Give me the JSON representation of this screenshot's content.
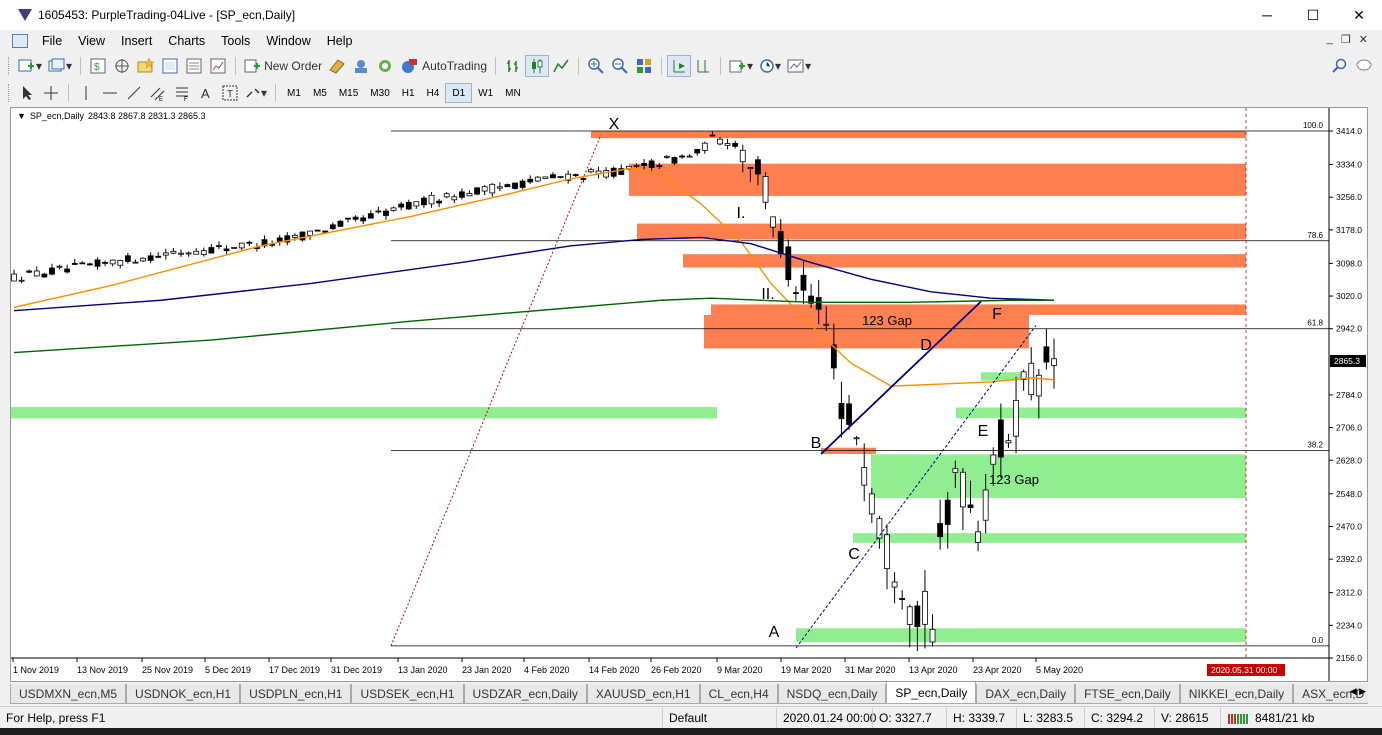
{
  "window": {
    "title": "1605453: PurpleTrading-04Live - [SP_ecn,Daily]",
    "minimize": "─",
    "maximize": "☐",
    "close": "✕"
  },
  "menu": [
    "File",
    "View",
    "Insert",
    "Charts",
    "Tools",
    "Window",
    "Help"
  ],
  "toolbar": {
    "new_order": "New Order",
    "autotrading": "AutoTrading"
  },
  "timeframes": [
    "M1",
    "M5",
    "M15",
    "M30",
    "H1",
    "H4",
    "D1",
    "W1",
    "MN"
  ],
  "active_timeframe": "D1",
  "chart": {
    "symbol_label": "SP_ecn,Daily",
    "ohlc": "2843.8 2867.8 2831.3 2865.3",
    "current_price": "2865.3",
    "end_date_marker": "2020.05.31 00:00",
    "price_ticks": [
      "3414.0",
      "3334.0",
      "3256.0",
      "3178.0",
      "3098.0",
      "3020.0",
      "2942.0",
      "2865.3",
      "2784.0",
      "2706.0",
      "2628.0",
      "2548.0",
      "2470.0",
      "2392.0",
      "2312.0",
      "2234.0",
      "2156.0"
    ],
    "date_ticks": [
      "1 Nov 2019",
      "13 Nov 2019",
      "25 Nov 2019",
      "5 Dec 2019",
      "17 Dec 2019",
      "31 Dec 2019",
      "13 Jan 2020",
      "23 Jan 2020",
      "4 Feb 2020",
      "14 Feb 2020",
      "26 Feb 2020",
      "9 Mar 2020",
      "19 Mar 2020",
      "31 Mar 2020",
      "13 Apr 2020",
      "23 Apr 2020",
      "5 May 2020"
    ],
    "fib_levels": [
      "100.0",
      "78.6",
      "61.8",
      "38.2",
      "0.0"
    ],
    "annotations": [
      "X",
      "I.",
      "II.",
      "123 Gap",
      "D",
      "F",
      "E",
      "B",
      "123 Gap",
      "C",
      "A"
    ],
    "colors": {
      "resistance_zone": "#ff7f50",
      "support_zone": "#90ee90",
      "ma_fast": "#ff8c00",
      "ma_mid": "#000080",
      "ma_slow": "#006400",
      "fib_line": "#000000",
      "projection": "#cc0000"
    }
  },
  "tabs": [
    "USDMXN_ecn,M5",
    "USDNOK_ecn,H1",
    "USDPLN_ecn,H1",
    "USDSEK_ecn,H1",
    "USDZAR_ecn,Daily",
    "XAUUSD_ecn,H1",
    "CL_ecn,H4",
    "NSDQ_ecn,Daily",
    "SP_ecn,Daily",
    "DAX_ecn,Daily",
    "FTSE_ecn,Daily",
    "NIKKEI_ecn,Daily",
    "ASX_ecn,D"
  ],
  "active_tab": "SP_ecn,Daily",
  "status": {
    "help": "For Help, press F1",
    "profile": "Default",
    "datetime": "2020.01.24 00:00",
    "open": "O: 3327.7",
    "high": "H: 3339.7",
    "low": "L: 3283.5",
    "close": "C: 3294.2",
    "volume": "V: 28615",
    "traffic": "8481/21 kb"
  }
}
